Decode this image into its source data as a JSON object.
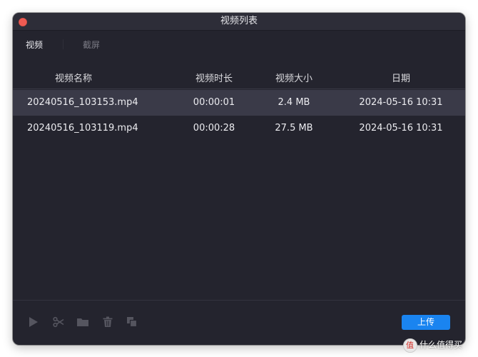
{
  "window": {
    "title": "视频列表"
  },
  "tabs": [
    {
      "label": "视频",
      "active": true
    },
    {
      "label": "截屏",
      "active": false
    }
  ],
  "table": {
    "columns": [
      "视频名称",
      "视频时长",
      "视频大小",
      "日期"
    ],
    "rows": [
      {
        "name": "20240516_103153.mp4",
        "duration": "00:00:01",
        "size": "2.4 MB",
        "date": "2024-05-16 10:31",
        "selected": true
      },
      {
        "name": "20240516_103119.mp4",
        "duration": "00:00:28",
        "size": "27.5 MB",
        "date": "2024-05-16 10:31",
        "selected": false
      }
    ]
  },
  "toolbar": {
    "icons": [
      "play-icon",
      "scissors-icon",
      "folder-icon",
      "trash-icon",
      "copy-icon"
    ],
    "upload_label": "上传"
  },
  "colors": {
    "window_bg": "#24242e",
    "selected_row": "#3a3a48",
    "accent": "#1a84f0",
    "close_button": "#ee5a52"
  },
  "watermark": {
    "text": "什么值得买"
  }
}
